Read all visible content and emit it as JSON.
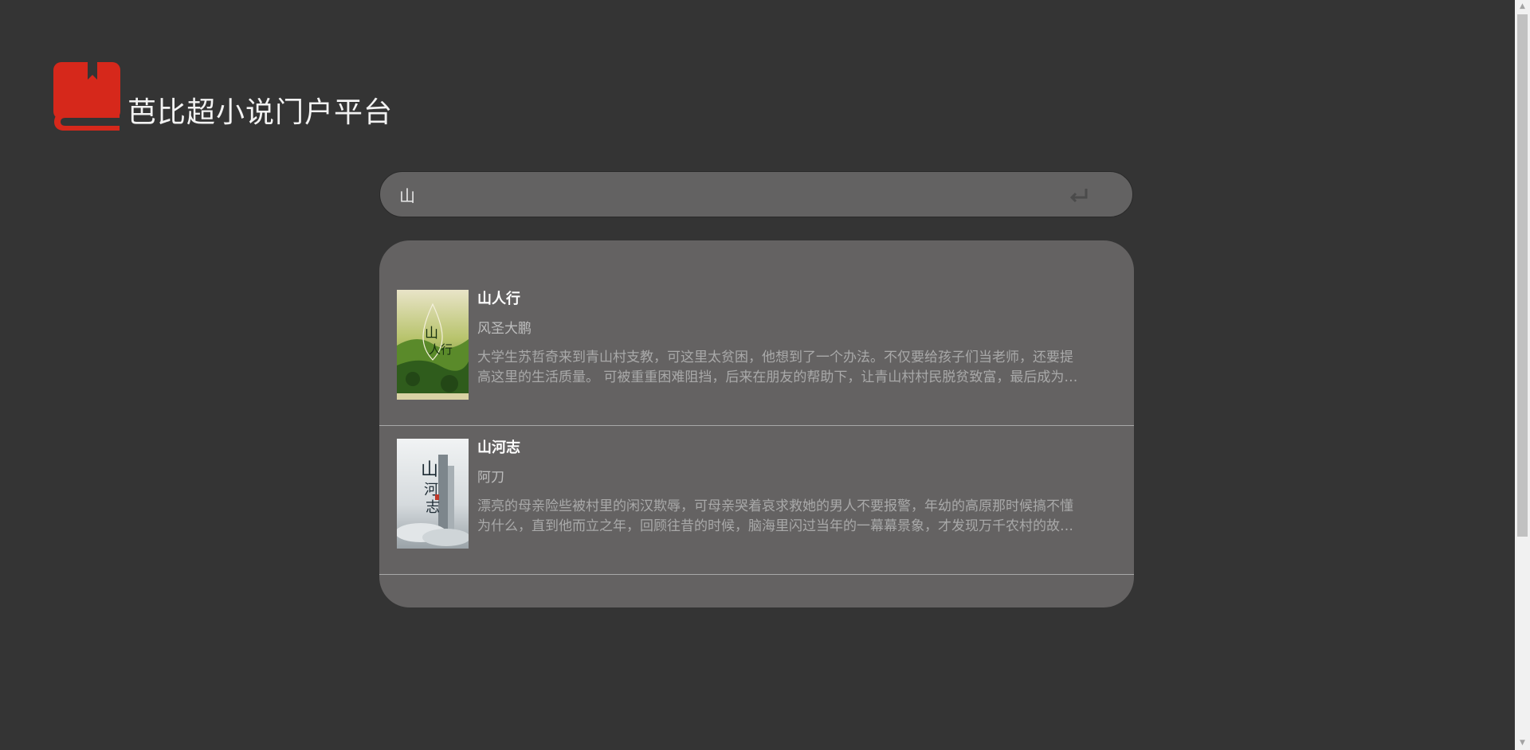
{
  "brand": {
    "name": "芭比超小说门户平台",
    "logo_color": "#d6281b"
  },
  "search": {
    "value": "山",
    "icon": "enter-icon"
  },
  "results": [
    {
      "title": "山人行",
      "author": "风圣大鹏",
      "description": "大学生苏哲奇来到青山村支教，可这里太贫困，他想到了一个办法。不仅要给孩子们当老师，还要提高这里的生活质量。 可被重重困难阻挡，后来在朋友的帮助下，让青山村村民脱贫致富，最后成为了远近闻名的富裕村。",
      "cover_text": "山人行"
    },
    {
      "title": "山河志",
      "author": "阿刀",
      "description": "漂亮的母亲险些被村里的闲汉欺辱，可母亲哭着哀求救她的男人不要报警，年幼的高原那时候搞不懂为什么，直到他而立之年，回顾往昔的时候，脑海里闪过当年的一幕幕景象，才发现万千农村的故事。",
      "cover_text": "山河志"
    }
  ],
  "colors": {
    "background": "#343434",
    "panel": "#646262",
    "accent": "#d6281b"
  }
}
